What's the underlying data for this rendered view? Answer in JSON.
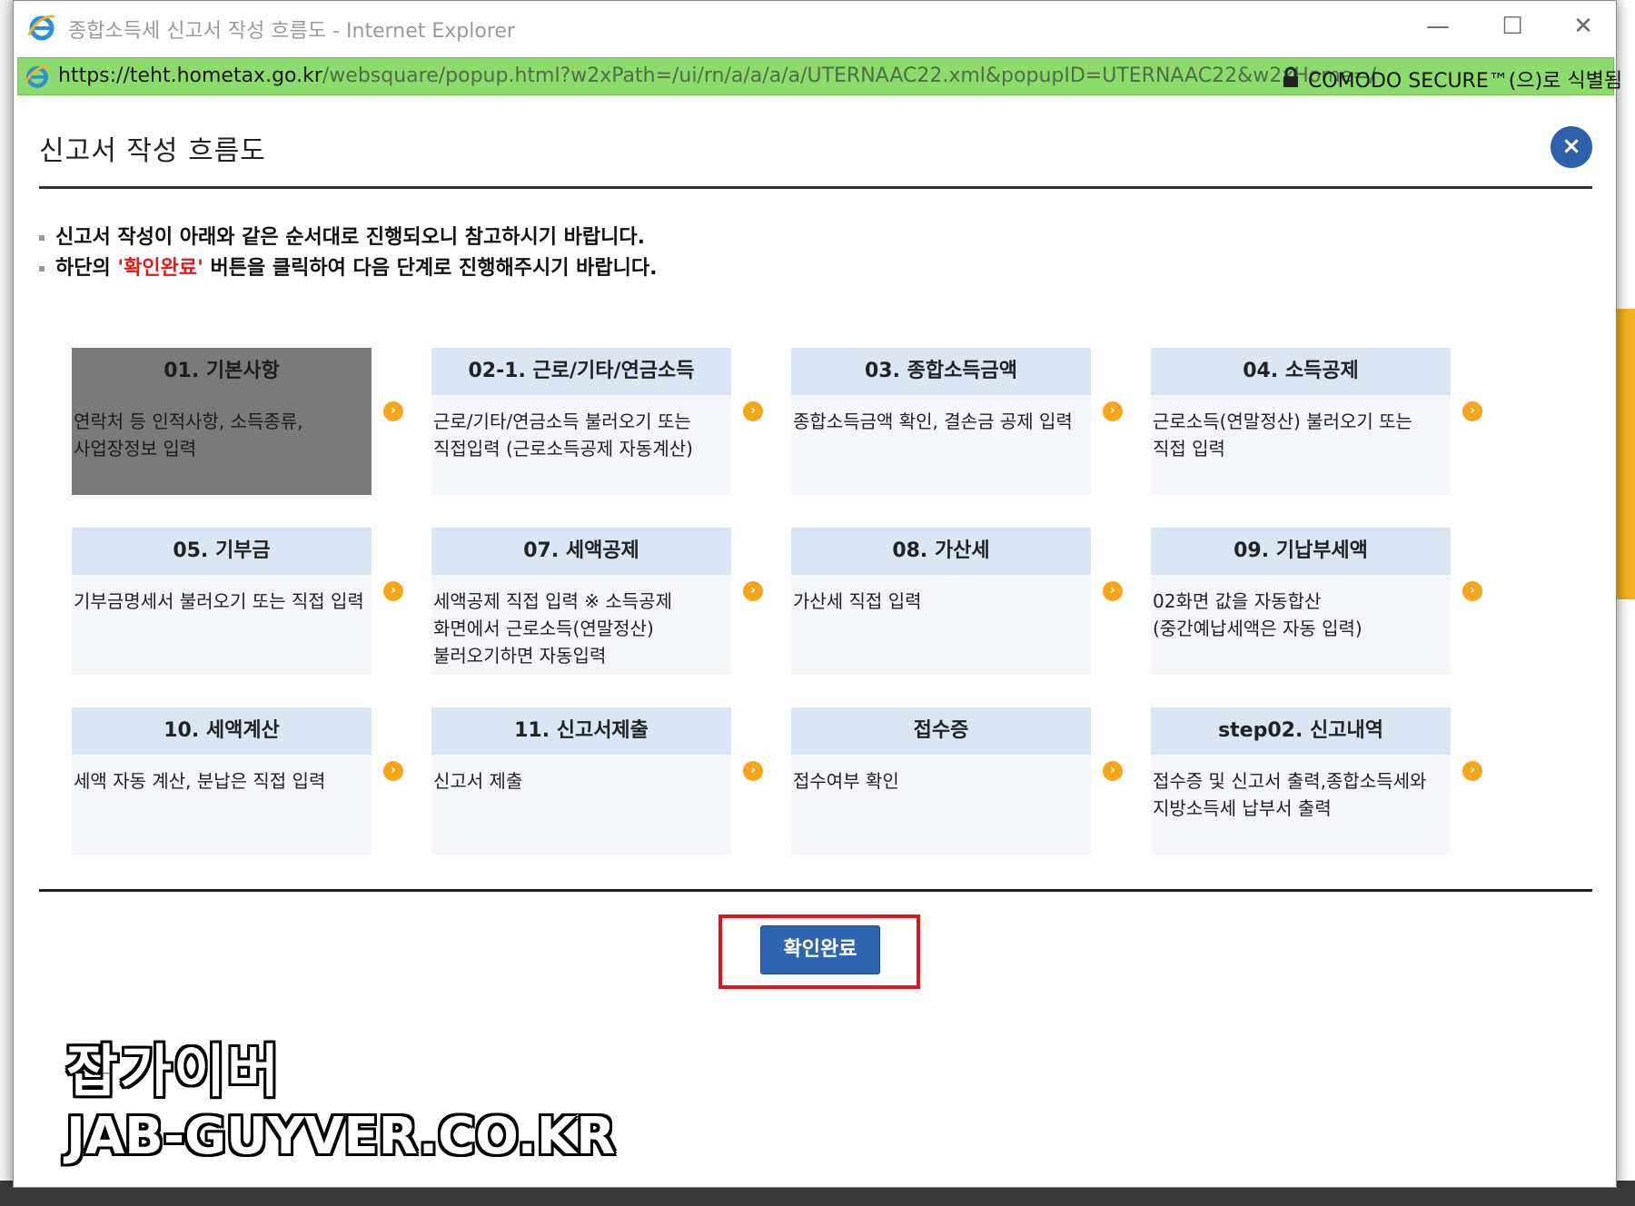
{
  "window": {
    "title": "종합소득세 신고서 작성 흐름도 - Internet Explorer",
    "min_glyph": "—",
    "max_glyph": "☐",
    "close_glyph": "✕"
  },
  "address": {
    "url_host": "https://teht.hometax.go.kr",
    "url_path": "/websquare/popup.html?w2xPath=/ui/rn/a/a/a/a/UTERNAAC22.xml&popupID=UTERNAAC22&w2xHome=/",
    "cert_label": "COMODO SECURE™(으)로 식별됨"
  },
  "popup": {
    "title": "신고서 작성 흐름도",
    "close_glyph": "×",
    "notice_1": "신고서 작성이 아래와 같은 순서대로 진행되오니 참고하시기 바랍니다.",
    "notice_2_pre": "하단의 ",
    "notice_2_red": "'확인완료'",
    "notice_2_post": " 버튼을 클릭하여 다음 단계로 진행해주시기 바랍니다."
  },
  "steps": [
    {
      "title": "01. 기본사항",
      "desc": "연락처 등 인적사항, 소득종류, 사업장정보 입력",
      "active": true
    },
    {
      "title": "02-1. 근로/기타/연금소득",
      "desc": "근로/기타/연금소득 불러오기 또는 직접입력 (근로소득공제 자동계산)"
    },
    {
      "title": "03. 종합소득금액",
      "desc": "종합소득금액 확인, 결손금 공제 입력"
    },
    {
      "title": "04. 소득공제",
      "desc": "근로소득(연말정산) 불러오기 또는 직접 입력"
    },
    {
      "title": "05. 기부금",
      "desc": "기부금명세서 불러오기 또는 직접 입력"
    },
    {
      "title": "07. 세액공제",
      "desc": "세액공제 직접 입력 ※ 소득공제 화면에서 근로소득(연말정산) 불러오기하면 자동입력"
    },
    {
      "title": "08. 가산세",
      "desc": "가산세 직접 입력"
    },
    {
      "title": "09. 기납부세액",
      "desc": "02화면 값을 자동합산 (중간예납세액은 자동 입력)"
    },
    {
      "title": "10. 세액계산",
      "desc": "세액 자동 계산, 분납은 직접 입력"
    },
    {
      "title": "11. 신고서제출",
      "desc": "신고서 제출"
    },
    {
      "title": "접수증",
      "desc": "접수여부 확인"
    },
    {
      "title": "step02. 신고내역",
      "desc": "접수증 및 신고서 출력,종합소득세와 지방소득세 납부서 출력"
    }
  ],
  "arrow_glyph": "›",
  "confirm_label": "확인완료",
  "watermark": {
    "ko": "잡가이버",
    "en": "JAB-GUYVER.CO.KR"
  },
  "colors": {
    "accent": "#2f64b0",
    "highlight": "#e2141a",
    "address_bar": "#8ddb6c",
    "step_head": "#dbe6f4",
    "arrow": "#f5a61b"
  }
}
